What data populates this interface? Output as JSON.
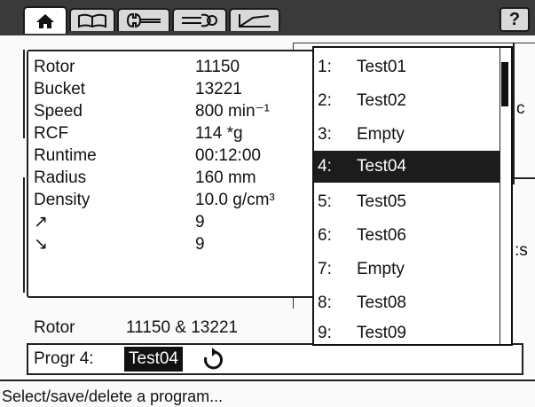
{
  "tabs": [
    {
      "icon": "home-icon",
      "active": true
    },
    {
      "icon": "book-icon",
      "active": false
    },
    {
      "icon": "wrench-icon",
      "active": false
    },
    {
      "icon": "tools-icon",
      "active": false
    },
    {
      "icon": "chart-icon",
      "active": false
    }
  ],
  "help_label": "?",
  "info": {
    "rows": [
      {
        "label": "Rotor",
        "value": "11150"
      },
      {
        "label": "Bucket",
        "value": "13221"
      },
      {
        "label": "Speed",
        "value": "800 min⁻¹"
      },
      {
        "label": "RCF",
        "value": "114 *g"
      },
      {
        "label": "Runtime",
        "value": "00:12:00"
      },
      {
        "label": "Radius",
        "value": "160 mm"
      },
      {
        "label": "Density",
        "value": "10.0 g/cm³"
      },
      {
        "label": "↗",
        "value": "9"
      },
      {
        "label": "↘",
        "value": "9"
      }
    ]
  },
  "rotor_line": {
    "label": "Rotor",
    "value": "11150 & 13221"
  },
  "program": {
    "label": "Progr 4:",
    "value": "Test04"
  },
  "status": "Select/save/delete a program...",
  "dropdown": {
    "items": [
      {
        "num": "1:",
        "name": "Test01"
      },
      {
        "num": "2:",
        "name": "Test02"
      },
      {
        "num": "3:",
        "name": "Empty"
      },
      {
        "num": "4:",
        "name": "Test04"
      },
      {
        "num": "5:",
        "name": "Test05"
      },
      {
        "num": "6:",
        "name": "Test06"
      },
      {
        "num": "7:",
        "name": "Empty"
      },
      {
        "num": "8:",
        "name": "Test08"
      },
      {
        "num": "9:",
        "name": "Test09"
      }
    ],
    "selected": "4:"
  },
  "peek": {
    "a": "c",
    "b": ":s"
  }
}
